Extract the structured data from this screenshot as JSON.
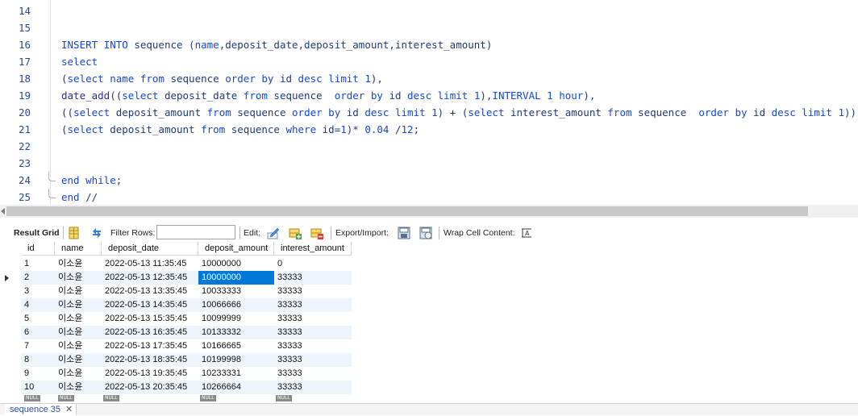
{
  "editor": {
    "lines": [
      {
        "num": "14",
        "tokens": []
      },
      {
        "num": "15",
        "tokens": []
      },
      {
        "num": "16",
        "tokens": [
          {
            "t": "INSERT INTO",
            "c": "kw"
          },
          {
            "t": " sequence (",
            "c": ""
          },
          {
            "t": "name",
            "c": "kw"
          },
          {
            "t": ",deposit_date,deposit_amount,interest_amount)",
            "c": ""
          }
        ]
      },
      {
        "num": "17",
        "tokens": [
          {
            "t": "select",
            "c": "kw"
          }
        ]
      },
      {
        "num": "18",
        "tokens": [
          {
            "t": "(",
            "c": ""
          },
          {
            "t": "select name from",
            "c": "kw"
          },
          {
            "t": " sequence ",
            "c": ""
          },
          {
            "t": "order by",
            "c": "kw"
          },
          {
            "t": " id ",
            "c": ""
          },
          {
            "t": "desc limit",
            "c": "kw"
          },
          {
            "t": " ",
            "c": ""
          },
          {
            "t": "1",
            "c": "num"
          },
          {
            "t": "),",
            "c": ""
          }
        ]
      },
      {
        "num": "19",
        "tokens": [
          {
            "t": "date_add",
            "c": "fn"
          },
          {
            "t": "((",
            "c": ""
          },
          {
            "t": "select",
            "c": "kw"
          },
          {
            "t": " deposit_date ",
            "c": ""
          },
          {
            "t": "from",
            "c": "kw"
          },
          {
            "t": " sequence  ",
            "c": ""
          },
          {
            "t": "order by",
            "c": "kw"
          },
          {
            "t": " id ",
            "c": ""
          },
          {
            "t": "desc limit",
            "c": "kw"
          },
          {
            "t": " ",
            "c": ""
          },
          {
            "t": "1",
            "c": "num"
          },
          {
            "t": "),",
            "c": ""
          },
          {
            "t": "INTERVAL",
            "c": "kw"
          },
          {
            "t": " ",
            "c": ""
          },
          {
            "t": "1",
            "c": "num"
          },
          {
            "t": " ",
            "c": ""
          },
          {
            "t": "hour",
            "c": "kw"
          },
          {
            "t": "),",
            "c": ""
          }
        ]
      },
      {
        "num": "20",
        "tokens": [
          {
            "t": "((",
            "c": ""
          },
          {
            "t": "select",
            "c": "kw"
          },
          {
            "t": " deposit_amount ",
            "c": ""
          },
          {
            "t": "from",
            "c": "kw"
          },
          {
            "t": " sequence ",
            "c": ""
          },
          {
            "t": "order by",
            "c": "kw"
          },
          {
            "t": " id ",
            "c": ""
          },
          {
            "t": "desc limit",
            "c": "kw"
          },
          {
            "t": " ",
            "c": ""
          },
          {
            "t": "1",
            "c": "num"
          },
          {
            "t": ") + (",
            "c": ""
          },
          {
            "t": "select",
            "c": "kw"
          },
          {
            "t": " interest_amount ",
            "c": ""
          },
          {
            "t": "from",
            "c": "kw"
          },
          {
            "t": " sequence  ",
            "c": ""
          },
          {
            "t": "order by",
            "c": "kw"
          },
          {
            "t": " id ",
            "c": ""
          },
          {
            "t": "desc limit",
            "c": "kw"
          },
          {
            "t": " ",
            "c": ""
          },
          {
            "t": "1",
            "c": "num"
          },
          {
            "t": ")),",
            "c": ""
          }
        ]
      },
      {
        "num": "21",
        "tokens": [
          {
            "t": "(",
            "c": ""
          },
          {
            "t": "select",
            "c": "kw"
          },
          {
            "t": " deposit_amount ",
            "c": ""
          },
          {
            "t": "from",
            "c": "kw"
          },
          {
            "t": " sequence ",
            "c": ""
          },
          {
            "t": "where",
            "c": "kw"
          },
          {
            "t": " id=",
            "c": ""
          },
          {
            "t": "1",
            "c": "num"
          },
          {
            "t": ")* ",
            "c": ""
          },
          {
            "t": "0.04",
            "c": "num"
          },
          {
            "t": " /",
            "c": ""
          },
          {
            "t": "12",
            "c": "num"
          },
          {
            "t": ";",
            "c": ""
          }
        ]
      },
      {
        "num": "22",
        "tokens": []
      },
      {
        "num": "23",
        "tokens": []
      },
      {
        "num": "24",
        "tokens": [
          {
            "t": "end while",
            "c": "kw"
          },
          {
            "t": ";",
            "c": ""
          }
        ]
      },
      {
        "num": "25",
        "tokens": [
          {
            "t": "end",
            "c": "kw"
          },
          {
            "t": " //",
            "c": ""
          }
        ]
      }
    ]
  },
  "toolbar": {
    "result_grid_label": "Result Grid",
    "filter_rows_label": "Filter Rows:",
    "filter_value": "",
    "edit_label": "Edit:",
    "export_import_label": "Export/Import:",
    "wrap_cell_label": "Wrap Cell Content:"
  },
  "grid": {
    "columns": [
      "id",
      "name",
      "deposit_date",
      "deposit_amount",
      "interest_amount"
    ],
    "rows": [
      [
        "1",
        "이소윤",
        "2022-05-13 11:35:45",
        "10000000",
        "0"
      ],
      [
        "2",
        "이소윤",
        "2022-05-13 12:35:45",
        "10000000",
        "33333"
      ],
      [
        "3",
        "이소윤",
        "2022-05-13 13:35:45",
        "10033333",
        "33333"
      ],
      [
        "4",
        "이소윤",
        "2022-05-13 14:35:45",
        "10066666",
        "33333"
      ],
      [
        "5",
        "이소윤",
        "2022-05-13 15:35:45",
        "10099999",
        "33333"
      ],
      [
        "6",
        "이소윤",
        "2022-05-13 16:35:45",
        "10133332",
        "33333"
      ],
      [
        "7",
        "이소윤",
        "2022-05-13 17:35:45",
        "10166665",
        "33333"
      ],
      [
        "8",
        "이소윤",
        "2022-05-13 18:35:45",
        "10199998",
        "33333"
      ],
      [
        "9",
        "이소윤",
        "2022-05-13 19:35:45",
        "10233331",
        "33333"
      ],
      [
        "10",
        "이소윤",
        "2022-05-13 20:35:45",
        "10266664",
        "33333"
      ]
    ],
    "selected_row": 1,
    "selected_col": 3,
    "null_label": "NULL"
  },
  "tabs": [
    {
      "label": "sequence 35",
      "close": "✕"
    }
  ],
  "colors": {
    "keyword": "#1347d8",
    "selection": "#0078d7",
    "row_alt": "#eef4fc"
  }
}
